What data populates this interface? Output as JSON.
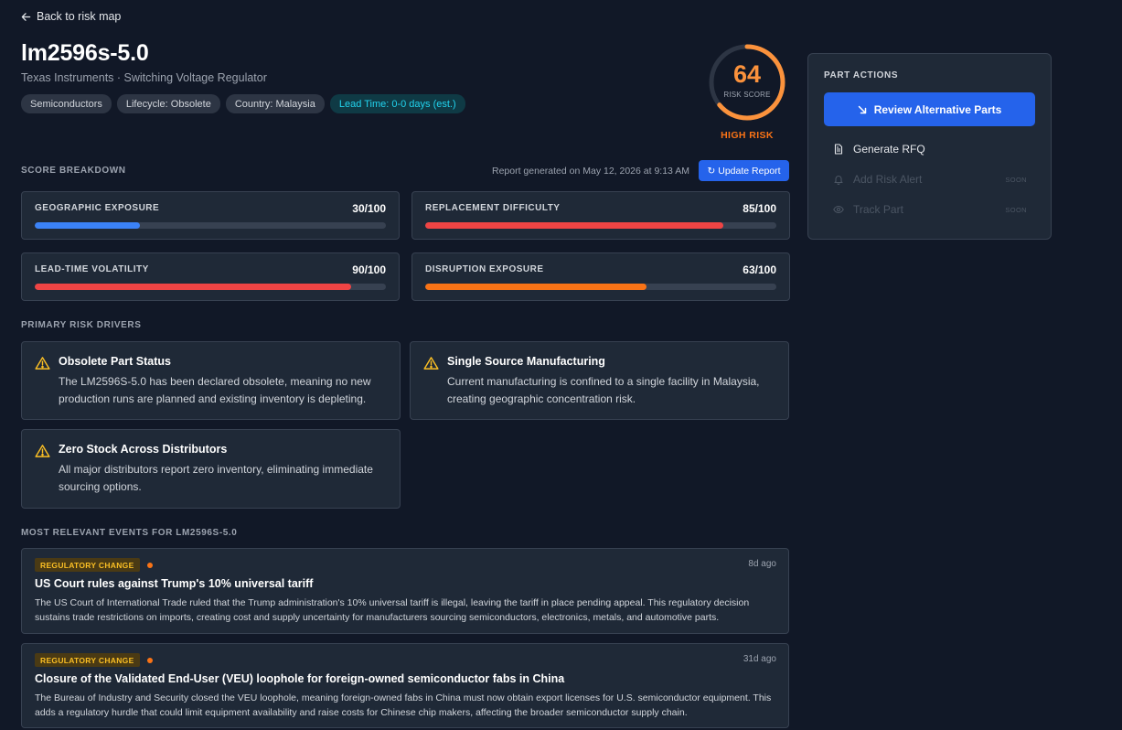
{
  "nav": {
    "back_label": "Back to risk map"
  },
  "part": {
    "name": "lm2596s-5.0",
    "subtitle": "Texas Instruments · Switching Voltage Regulator",
    "tags": [
      "Semiconductors",
      "Lifecycle: Obsolete",
      "Country: Malaysia",
      "Lead Time: 0-0 days (est.)"
    ]
  },
  "risk": {
    "score": "64",
    "score_fraction": 0.64,
    "score_label": "RISK SCORE",
    "level": "HIGH RISK",
    "accent_color": "#fb923c"
  },
  "breakdown": {
    "title": "SCORE BREAKDOWN",
    "report_generated": "Report generated on May 12, 2026 at 9:13 AM",
    "update_label": "Update Report",
    "items": [
      {
        "label": "GEOGRAPHIC EXPOSURE",
        "value": "30/100",
        "score": 30,
        "color": "#3b82f6"
      },
      {
        "label": "REPLACEMENT DIFFICULTY",
        "value": "85/100",
        "score": 85,
        "color": "#ef4444"
      },
      {
        "label": "LEAD-TIME VOLATILITY",
        "value": "90/100",
        "score": 90,
        "color": "#ef4444"
      },
      {
        "label": "DISRUPTION EXPOSURE",
        "value": "63/100",
        "score": 63,
        "color": "#f97316"
      }
    ]
  },
  "drivers": {
    "title": "PRIMARY RISK DRIVERS",
    "items": [
      {
        "title": "Obsolete Part Status",
        "desc": "The LM2596S-5.0 has been declared obsolete, meaning no new production runs are planned and existing inventory is depleting."
      },
      {
        "title": "Single Source Manufacturing",
        "desc": "Current manufacturing is confined to a single facility in Malaysia, creating geographic concentration risk."
      },
      {
        "title": "Zero Stock Across Distributors",
        "desc": "All major distributors report zero inventory, eliminating immediate sourcing options."
      }
    ]
  },
  "events": {
    "title": "MOST RELEVANT EVENTS FOR LM2596S-5.0",
    "items": [
      {
        "badge": "REGULATORY CHANGE",
        "ago": "8d ago",
        "title": "US Court rules against Trump's 10% universal tariff",
        "desc": "The US Court of International Trade ruled that the Trump administration's 10% universal tariff is illegal, leaving the tariff in place pending appeal. This regulatory decision sustains trade restrictions on imports, creating cost and supply uncertainty for manufacturers sourcing semiconductors, electronics, metals, and automotive parts."
      },
      {
        "badge": "REGULATORY CHANGE",
        "ago": "31d ago",
        "title": "Closure of the Validated End-User (VEU) loophole for foreign-owned semiconductor fabs in China",
        "desc": "The Bureau of Industry and Security closed the VEU loophole, meaning foreign-owned fabs in China must now obtain export licenses for U.S. semiconductor equipment. This adds a regulatory hurdle that could limit equipment availability and raise costs for Chinese chip makers, affecting the broader semiconductor supply chain."
      }
    ]
  },
  "actions": {
    "title": "PART ACTIONS",
    "primary": "Review Alternative Parts",
    "items": [
      {
        "label": "Generate RFQ",
        "icon": "document-icon",
        "soon": ""
      },
      {
        "label": "Add Risk Alert",
        "icon": "bell-icon",
        "soon": "SOON"
      },
      {
        "label": "Track Part",
        "icon": "eye-icon",
        "soon": "SOON"
      }
    ]
  }
}
